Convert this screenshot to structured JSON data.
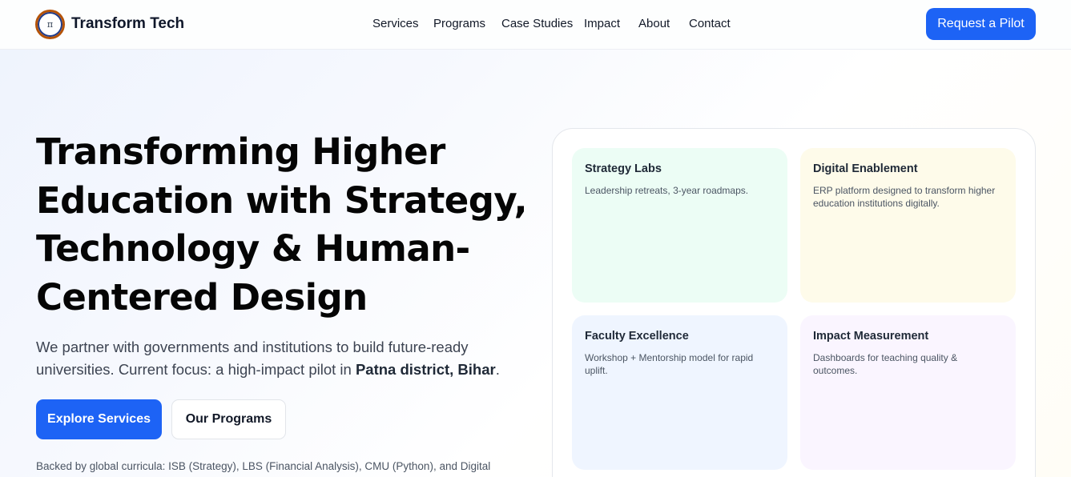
{
  "header": {
    "brand": "Transform Tech",
    "logo_glyph": "π",
    "nav": [
      "Services",
      "Programs",
      "Case Studies",
      "Impact",
      "About",
      "Contact"
    ],
    "cta": "Request a Pilot"
  },
  "hero": {
    "headline": "Transforming Higher Education with Strategy, Technology & Human-Centered Design",
    "lede_prefix": "We partner with governments and institutions to build future-ready universities. Current focus: a high-impact pilot in ",
    "lede_bold": "Patna district, Bihar",
    "lede_suffix": ".",
    "primary_button": "Explore Services",
    "secondary_button": "Our Programs",
    "backed_by": "Backed by global curricula: ISB (Strategy), LBS (Financial Analysis), CMU (Python), and Digital"
  },
  "cards": [
    {
      "title": "Strategy Labs",
      "desc": "Leadership retreats, 3-year roadmaps."
    },
    {
      "title": "Digital Enablement",
      "desc": "ERP platform designed to transform higher education institutions digitally."
    },
    {
      "title": "Faculty Excellence",
      "desc": "Workshop + Mentorship model for rapid uplift."
    },
    {
      "title": "Impact Measurement",
      "desc": "Dashboards for teaching quality & outcomes."
    }
  ],
  "colors": {
    "accent": "#1d63f5",
    "card_green": "#ecfdf5",
    "card_yellow": "#fefbea",
    "card_blue": "#eff5ff",
    "card_purple": "#faf5ff"
  }
}
